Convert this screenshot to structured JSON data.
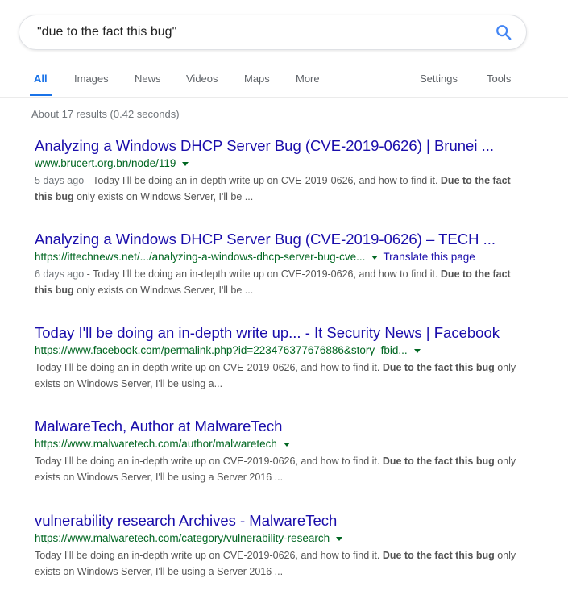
{
  "search": {
    "query": "\"due to the fact this bug\""
  },
  "tabs": {
    "all": "All",
    "images": "Images",
    "news": "News",
    "videos": "Videos",
    "maps": "Maps",
    "more": "More",
    "settings": "Settings",
    "tools": "Tools"
  },
  "stats": "About 17 results (0.42 seconds)",
  "results": [
    {
      "title": "Analyzing a Windows DHCP Server Bug (CVE-2019-0626) | Brunei ...",
      "url": "www.brucert.org.bn/node/119",
      "date": "5 days ago",
      "sep": " - ",
      "snippet_pre": "Today I'll be doing an in-depth write up on CVE-2019-0626, and how to find it. ",
      "snippet_bold": "Due to the fact this bug",
      "snippet_post": " only exists on Windows Server, I'll be ..."
    },
    {
      "title": "Analyzing a Windows DHCP Server Bug (CVE-2019-0626) – TECH ...",
      "url": "https://ittechnews.net/.../analyzing-a-windows-dhcp-server-bug-cve...",
      "translate": "Translate this page",
      "date": "6 days ago",
      "sep": " - ",
      "snippet_pre": "Today I'll be doing an in-depth write up on CVE-2019-0626, and how to find it. ",
      "snippet_bold": "Due to the fact this bug",
      "snippet_post": " only exists on Windows Server, I'll be ..."
    },
    {
      "title": "Today I'll be doing an in-depth write up... - It Security News | Facebook",
      "url": "https://www.facebook.com/permalink.php?id=223476377676886&story_fbid...",
      "snippet_pre": "Today I'll be doing an in-depth write up on CVE-2019-0626, and how to find it. ",
      "snippet_bold": "Due to the fact this bug",
      "snippet_post": " only exists on Windows Server, I'll be using a..."
    },
    {
      "title": "MalwareTech, Author at MalwareTech",
      "url": "https://www.malwaretech.com/author/malwaretech",
      "snippet_pre": "Today I'll be doing an in-depth write up on CVE-2019-0626, and how to find it. ",
      "snippet_bold": "Due to the fact this bug",
      "snippet_post": " only exists on Windows Server, I'll be using a Server 2016 ..."
    },
    {
      "title": "vulnerability research Archives - MalwareTech",
      "url": "https://www.malwaretech.com/category/vulnerability-research",
      "snippet_pre": "Today I'll be doing an in-depth write up on CVE-2019-0626, and how to find it. ",
      "snippet_bold": "Due to the fact this bug",
      "snippet_post": " only exists on Windows Server, I'll be using a Server 2016 ..."
    }
  ]
}
